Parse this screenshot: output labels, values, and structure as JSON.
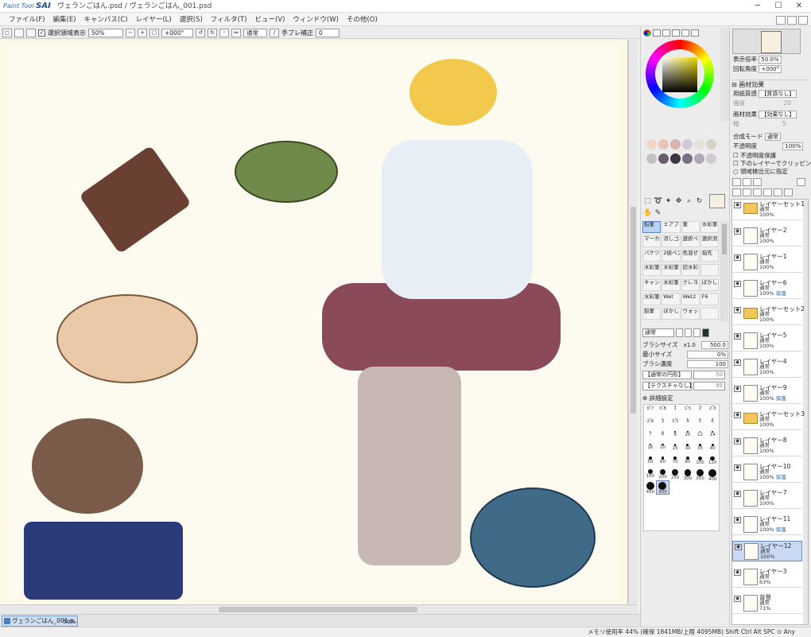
{
  "window": {
    "logo_brand": "Paint Tool",
    "logo_name": "SAI",
    "title": "ヴェランごはん.psd / ヴェランごはん_001.psd",
    "minimize": "─",
    "maximize": "☐",
    "close": "✕"
  },
  "menubar": {
    "items": [
      "ファイル(F)",
      "編集(E)",
      "キャンバス(C)",
      "レイヤー(L)",
      "選択(S)",
      "フィルタ(T)",
      "ビュー(V)",
      "ウィンドウ(W)",
      "その他(O)"
    ]
  },
  "toolbar": {
    "selection_display_label": "選択領域表示",
    "selection_display_checked": "✓",
    "zoom": "50%",
    "rotation": "+000°",
    "blend_mode": "通常",
    "stabilizer_label": "手ブレ補正",
    "stabilizer_value": "0"
  },
  "colors": {
    "canvas_bg": "#fbf8e8",
    "selected_layer": "#c9d8f3",
    "selected_brush": "#bcd3f0",
    "accent": "#2a6fb0"
  },
  "color_panel": {
    "swatches": [
      "#f0d7c8",
      "#e8c3b8",
      "#d9b3b0",
      "#d4c8d6",
      "#e4e0da",
      "#d8d2c8",
      "#c7c1c4",
      "#6b5c6d",
      "#3c3542",
      "#7a6d86",
      "#b0a8b8",
      "#cfc9d0"
    ]
  },
  "brushes": [
    {
      "label": "鉛筆"
    },
    {
      "label": "エアブラシ"
    },
    {
      "label": "筆"
    },
    {
      "label": "水彩筆"
    },
    {
      "label": "マーカー"
    },
    {
      "label": "消しゴム"
    },
    {
      "label": "選択ペン"
    },
    {
      "label": "選択消し"
    },
    {
      "label": "バケツ"
    },
    {
      "label": "2値ペン"
    },
    {
      "label": "色混ぜ"
    },
    {
      "label": "指先"
    },
    {
      "label": "水彩筆"
    },
    {
      "label": "水彩筆"
    },
    {
      "label": "旧水彩"
    },
    {
      "label": ""
    },
    {
      "label": "キャンバス"
    },
    {
      "label": "水彩筆"
    },
    {
      "label": "クレヨン"
    },
    {
      "label": "ぼかし"
    },
    {
      "label": "水彩筆"
    },
    {
      "label": "Wet"
    },
    {
      "label": "Wet2"
    },
    {
      "label": "F6"
    },
    {
      "label": "鉛筆"
    },
    {
      "label": "ぼかし"
    },
    {
      "label": "ウォッシュ"
    },
    {
      "label": ""
    }
  ],
  "brush_props": {
    "mode": "通常",
    "size_label": "ブラシサイズ",
    "size_mult": "x1.0",
    "size_value": "500.0",
    "min_size_label": "最小サイズ",
    "min_size_value": "0%",
    "density_label": "ブラシ濃度",
    "density_value": "100",
    "shape_label": "【通常の円形】",
    "shape_value": "50",
    "texture_label": "【テクスチャなし】",
    "texture_value": "95",
    "detail_label": "詳細設定"
  },
  "size_presets": [
    "0.7",
    "0.8",
    "1",
    "1.5",
    "2",
    "2.3",
    "2.6",
    "3",
    "3.5",
    "4",
    "5",
    "6",
    "7",
    "8",
    "9",
    "10",
    "12",
    "14",
    "16",
    "20",
    "25",
    "30",
    "35",
    "40",
    "50",
    "60",
    "70",
    "80",
    "100",
    "120",
    "160",
    "200",
    "250",
    "300",
    "350",
    "400",
    "450",
    "500"
  ],
  "navigator": {
    "zoom_label": "表示倍率",
    "zoom_value": "50.0%",
    "angle_label": "回転角度",
    "angle_value": "+000°"
  },
  "paper": {
    "section": "画材効果",
    "texture_label": "用紙質感",
    "texture_value": "【質感なし】",
    "texture_sub": "強度",
    "texture_sub_val": "20",
    "effect_label": "画材効果",
    "effect_value": "【効果なし】",
    "effect_sub": "幅",
    "effect_sub_val": "5"
  },
  "layer_props": {
    "blend_label": "合成モード",
    "blend_value": "通常",
    "opacity_label": "不透明度",
    "opacity_value": "100%",
    "protect_label": "不透明度保護",
    "clip_label": "下のレイヤーでクリッピング",
    "source_label": "領域検出元に指定"
  },
  "layers": [
    {
      "name": "レイヤーセット1",
      "blend": "通常",
      "opacity": "100%",
      "type": "folder",
      "tag": ""
    },
    {
      "name": "レイヤー2",
      "blend": "通常",
      "opacity": "100%",
      "type": "layer",
      "tag": ""
    },
    {
      "name": "レイヤー1",
      "blend": "通常",
      "opacity": "100%",
      "type": "layer",
      "tag": ""
    },
    {
      "name": "レイヤー6",
      "blend": "通常",
      "opacity": "100%",
      "type": "layer",
      "tag": "保護"
    },
    {
      "name": "レイヤーセット2",
      "blend": "通常",
      "opacity": "100%",
      "type": "folder",
      "tag": ""
    },
    {
      "name": "レイヤー5",
      "blend": "通常",
      "opacity": "100%",
      "type": "layer",
      "tag": ""
    },
    {
      "name": "レイヤー4",
      "blend": "通常",
      "opacity": "100%",
      "type": "layer",
      "tag": ""
    },
    {
      "name": "レイヤー9",
      "blend": "通常",
      "opacity": "100%",
      "type": "layer",
      "tag": "保護"
    },
    {
      "name": "レイヤーセット3",
      "blend": "通常",
      "opacity": "100%",
      "type": "folder",
      "tag": ""
    },
    {
      "name": "レイヤー8",
      "blend": "通常",
      "opacity": "100%",
      "type": "layer",
      "tag": ""
    },
    {
      "name": "レイヤー10",
      "blend": "通常",
      "opacity": "100%",
      "type": "layer",
      "tag": "保護"
    },
    {
      "name": "レイヤー7",
      "blend": "通常",
      "opacity": "100%",
      "type": "layer",
      "tag": ""
    },
    {
      "name": "レイヤー11",
      "blend": "通常",
      "opacity": "100%",
      "type": "layer",
      "tag": "保護"
    },
    {
      "name": "レイヤー12",
      "blend": "通常",
      "opacity": "100%",
      "type": "layer",
      "tag": "",
      "selected": true
    },
    {
      "name": "レイヤー3",
      "blend": "通常",
      "opacity": "63%",
      "type": "layer",
      "tag": ""
    },
    {
      "name": "背景",
      "blend": "通常",
      "opacity": "71%",
      "type": "layer",
      "tag": ""
    }
  ],
  "doc_tab": {
    "name": "ヴェランごはん_001.p..",
    "zoom": "50%"
  },
  "status": {
    "memory": "メモリ使用率 44% (確保 1841MB/上限 4095MB)",
    "keys": "Shift Ctrl Alt SPC ⊙ Any"
  }
}
